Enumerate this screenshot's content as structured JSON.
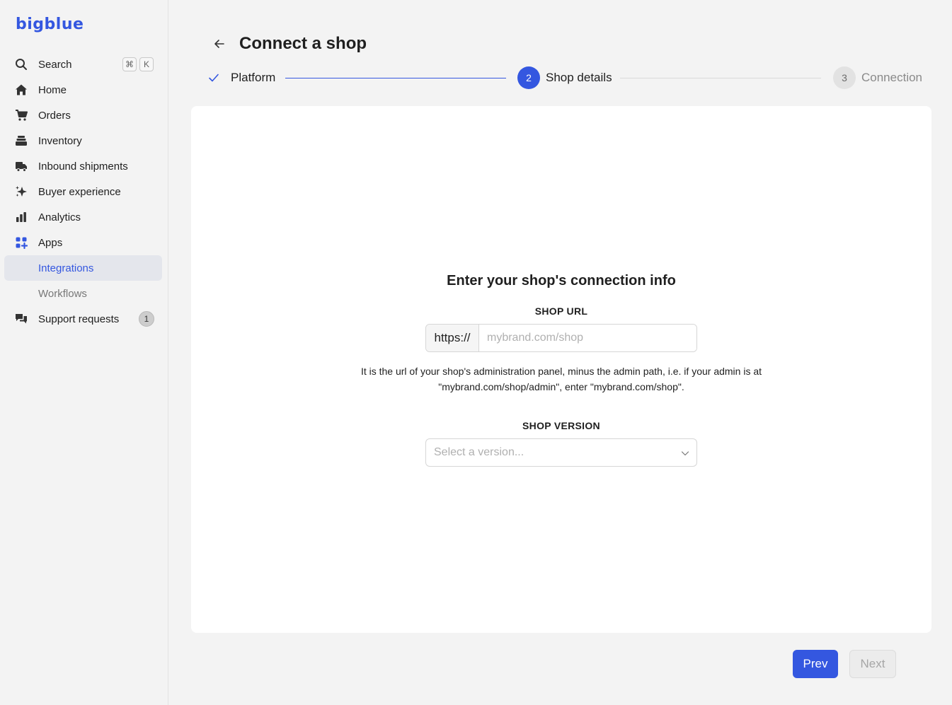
{
  "app": {
    "logo": "bigblue"
  },
  "sidebar": {
    "items": [
      {
        "label": "Search",
        "icon": "search-icon",
        "shortcut": [
          "⌘",
          "K"
        ]
      },
      {
        "label": "Home",
        "icon": "home-icon"
      },
      {
        "label": "Orders",
        "icon": "cart-icon"
      },
      {
        "label": "Inventory",
        "icon": "inventory-icon"
      },
      {
        "label": "Inbound shipments",
        "icon": "truck-icon"
      },
      {
        "label": "Buyer experience",
        "icon": "sparkles-icon"
      },
      {
        "label": "Analytics",
        "icon": "bar-chart-icon"
      },
      {
        "label": "Apps",
        "icon": "apps-grid-icon"
      },
      {
        "label": "Integrations",
        "active": true
      },
      {
        "label": "Workflows"
      },
      {
        "label": "Support requests",
        "icon": "chat-icon",
        "badge": "1"
      }
    ]
  },
  "header": {
    "title": "Connect a shop"
  },
  "stepper": {
    "steps": [
      {
        "number": "1",
        "label": "Platform",
        "state": "completed"
      },
      {
        "number": "2",
        "label": "Shop details",
        "state": "current"
      },
      {
        "number": "3",
        "label": "Connection",
        "state": "upcoming"
      }
    ]
  },
  "form": {
    "heading": "Enter your shop's connection info",
    "shop_url": {
      "label": "SHOP URL",
      "prefix": "https://",
      "placeholder": "mybrand.com/shop",
      "help": "It is the url of your shop's administration panel, minus the admin path, i.e. if your admin is at \"mybrand.com/shop/admin\", enter \"mybrand.com/shop\"."
    },
    "shop_version": {
      "label": "SHOP VERSION",
      "placeholder": "Select a version..."
    }
  },
  "footer": {
    "prev_label": "Prev",
    "next_label": "Next"
  },
  "colors": {
    "accent": "#3457e0",
    "background": "#f3f3f3",
    "card": "#ffffff"
  }
}
